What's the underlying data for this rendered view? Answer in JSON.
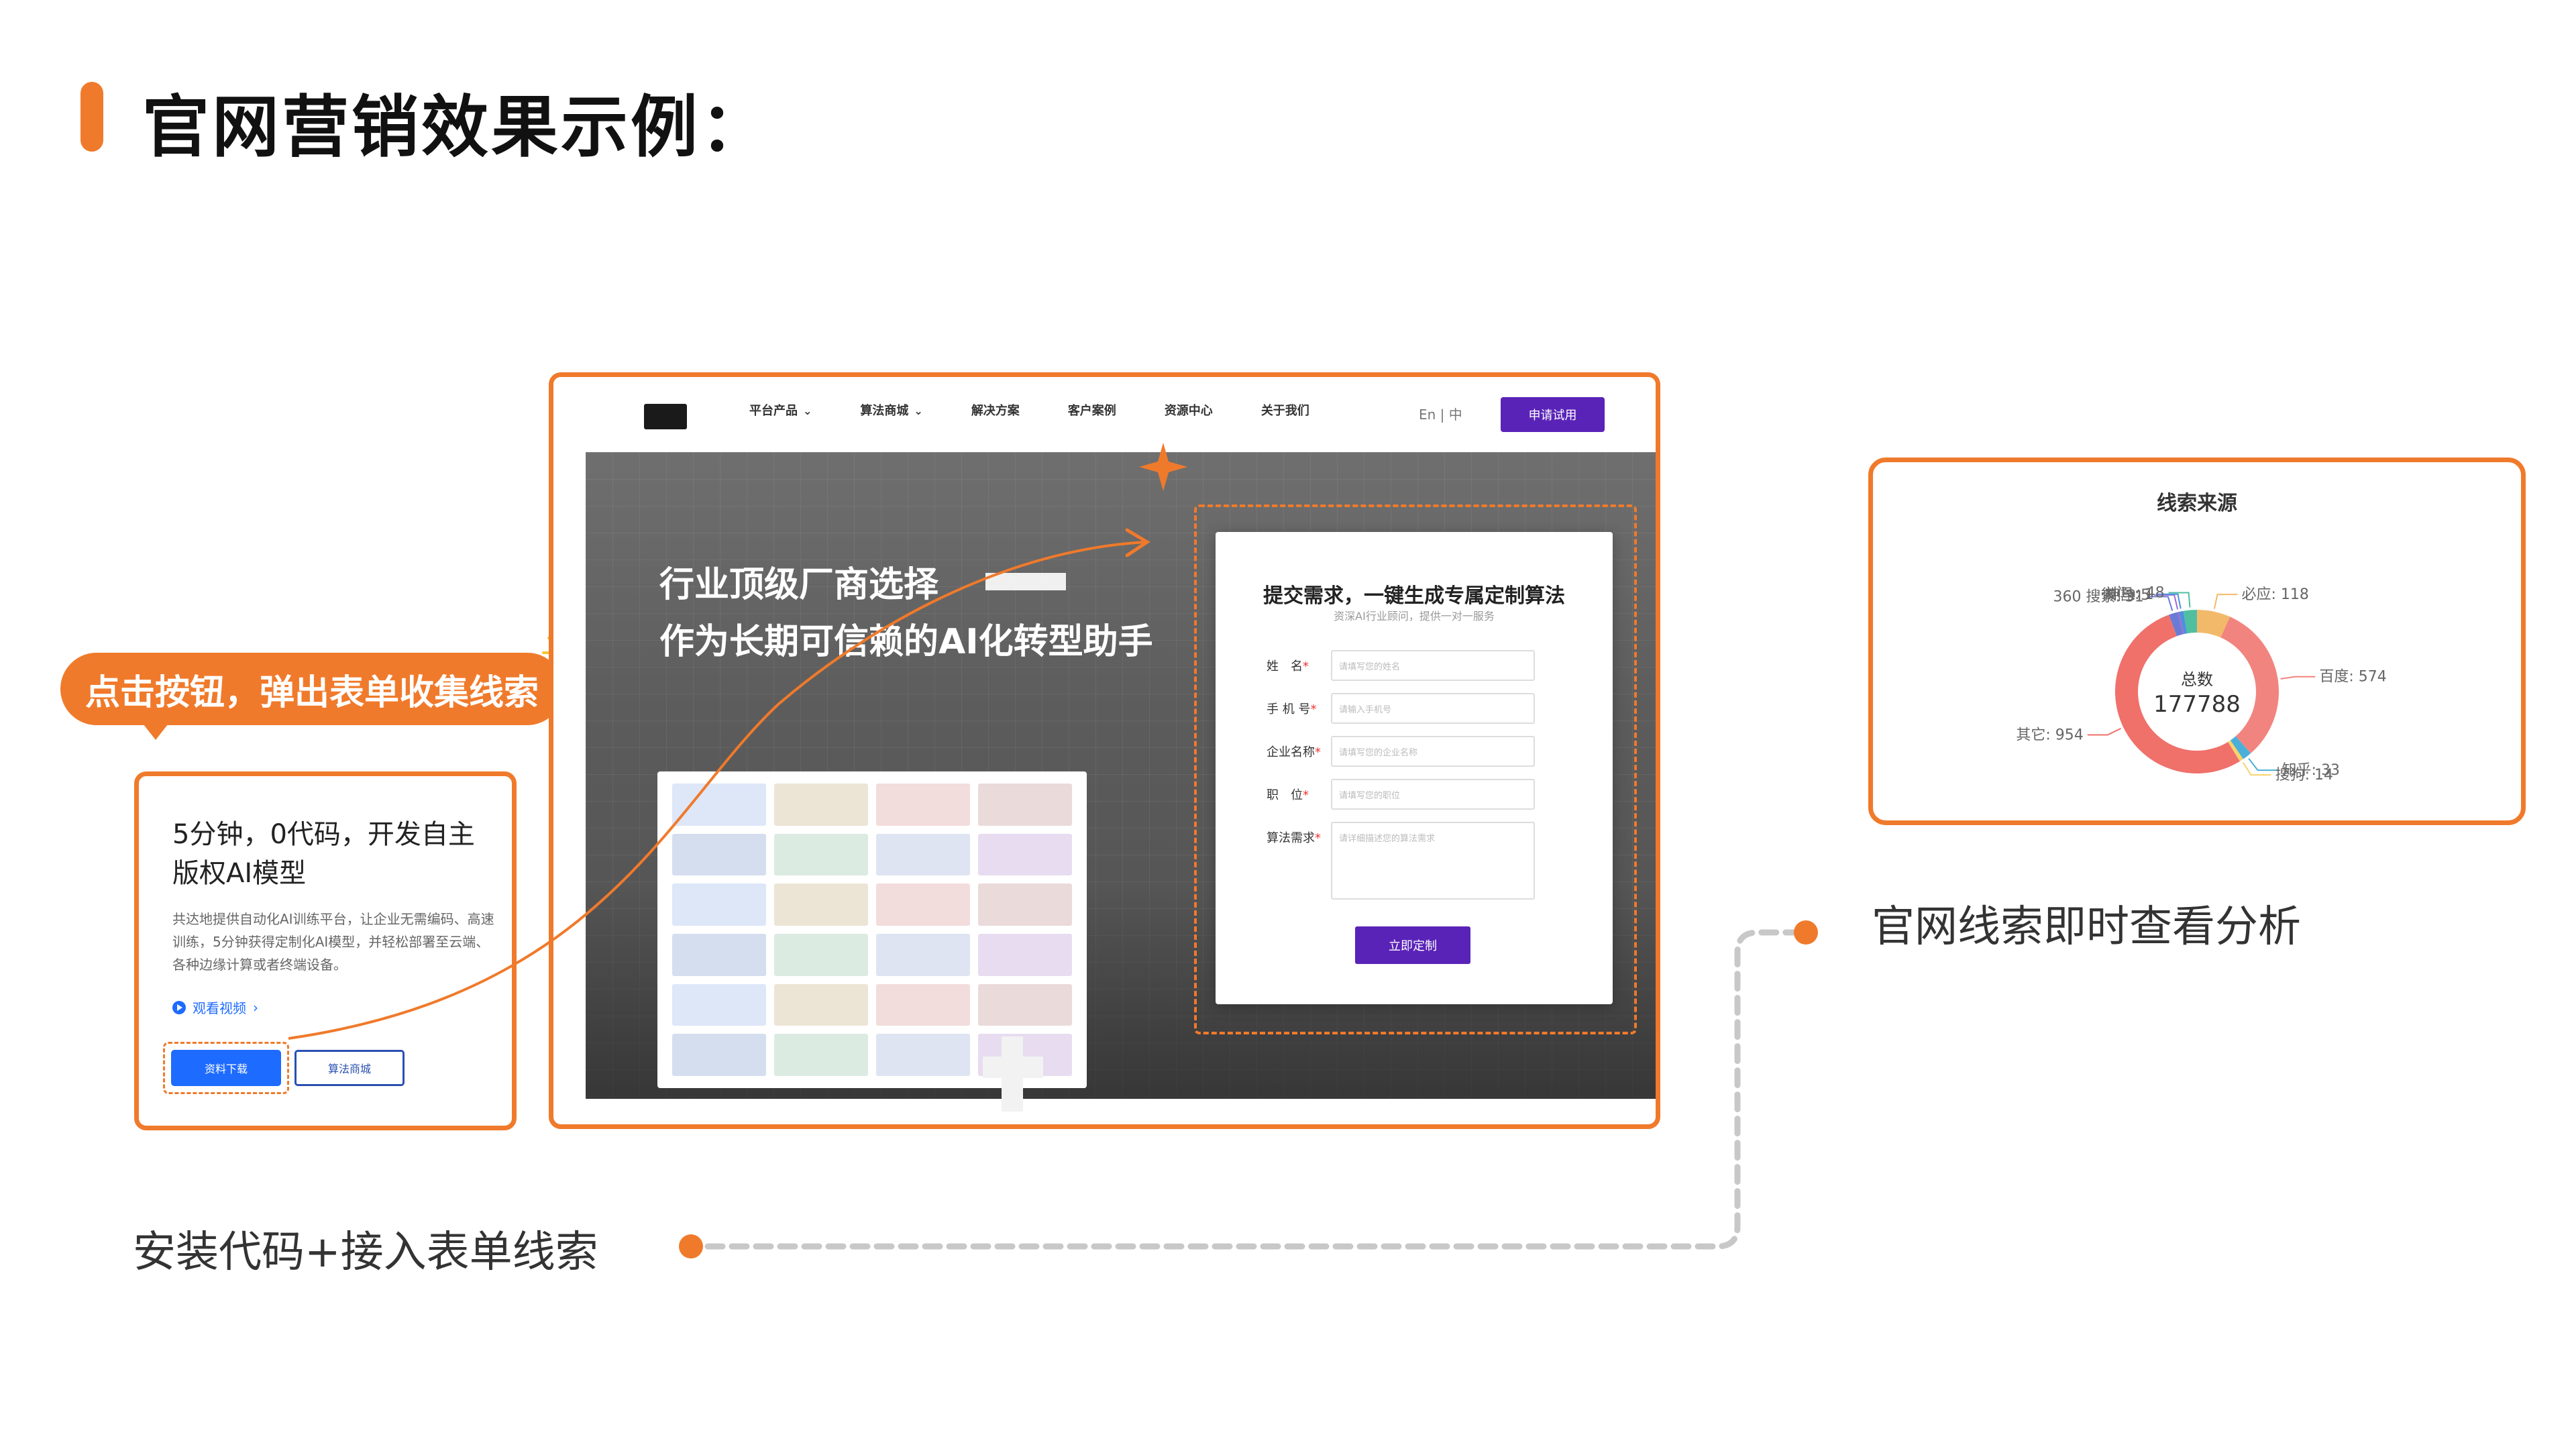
{
  "slide": {
    "title": "官网营销效果示例：",
    "caption_left": "安装代码+接入表单线索",
    "caption_right": "官网线索即时查看分析",
    "callout": "点击按钮，弹出表单收集线索",
    "accent_color": "#f07a2b"
  },
  "site": {
    "nav": [
      {
        "label": "平台产品",
        "has_chevron": true
      },
      {
        "label": "算法商城",
        "has_chevron": true
      },
      {
        "label": "解决方案",
        "has_chevron": false
      },
      {
        "label": "客户案例",
        "has_chevron": false
      },
      {
        "label": "资源中心",
        "has_chevron": false
      },
      {
        "label": "关于我们",
        "has_chevron": false
      }
    ],
    "lang": "En | 中",
    "trial_button": "申请试用",
    "hero_line1": "行业顶级厂商选择",
    "hero_line2": "作为长期可信赖的AI化转型助手",
    "brand_color": "#5a23b8"
  },
  "form": {
    "title": "提交需求，一键生成专属定制算法",
    "subtitle": "资深AI行业顾问，提供一对一服务",
    "fields": [
      {
        "label": "姓　名",
        "placeholder": "请填写您的姓名"
      },
      {
        "label": "手 机 号",
        "placeholder": "请输入手机号"
      },
      {
        "label": "企业名称",
        "placeholder": "请填写您的企业名称"
      },
      {
        "label": "职　位",
        "placeholder": "请填写您的职位"
      },
      {
        "label": "算法需求",
        "placeholder": "请详细描述您的算法需求"
      }
    ],
    "submit": "立即定制"
  },
  "card": {
    "title": "5分钟，0代码，开发自主版权AI模型",
    "description": "共达地提供自动化AI训练平台，让企业无需编码、高速训练，5分钟获得定制化AI模型，并轻松部署至云端、各种边缘计算或者终端设备。",
    "video_link": "观看视频",
    "download_button": "资料下载",
    "mall_button": "算法商城",
    "link_color": "#1e6bff"
  },
  "chart_data": {
    "type": "pie",
    "title": "线索来源",
    "center_label": "总数",
    "center_value": "177788",
    "slices": [
      {
        "name": "360 搜索",
        "value_label": "31",
        "value": 3100,
        "color": "#6a7bd6"
      },
      {
        "name": "微信",
        "value_label": "5",
        "value": 600,
        "color": "#9b6bd0"
      },
      {
        "name": "神马",
        "value_label": "1",
        "value": 1500,
        "color": "#4d8fe0"
      },
      {
        "name": "qita",
        "value_label": "48",
        "value": 4800,
        "color": "#4fbfa0"
      },
      {
        "name": "必应",
        "value_label": "118",
        "value": 11800,
        "color": "#f3b96a"
      },
      {
        "name": "百度",
        "value_label": "574",
        "value": 57400,
        "color": "#f2847f"
      },
      {
        "name": "知乎",
        "value_label": "33",
        "value": 3300,
        "color": "#4ab0d9"
      },
      {
        "name": "搜狗",
        "value_label": "14",
        "value": 1400,
        "color": "#f7d36b"
      },
      {
        "name": "其它",
        "value_label": "954",
        "value": 95400,
        "color": "#f0706a"
      }
    ]
  }
}
